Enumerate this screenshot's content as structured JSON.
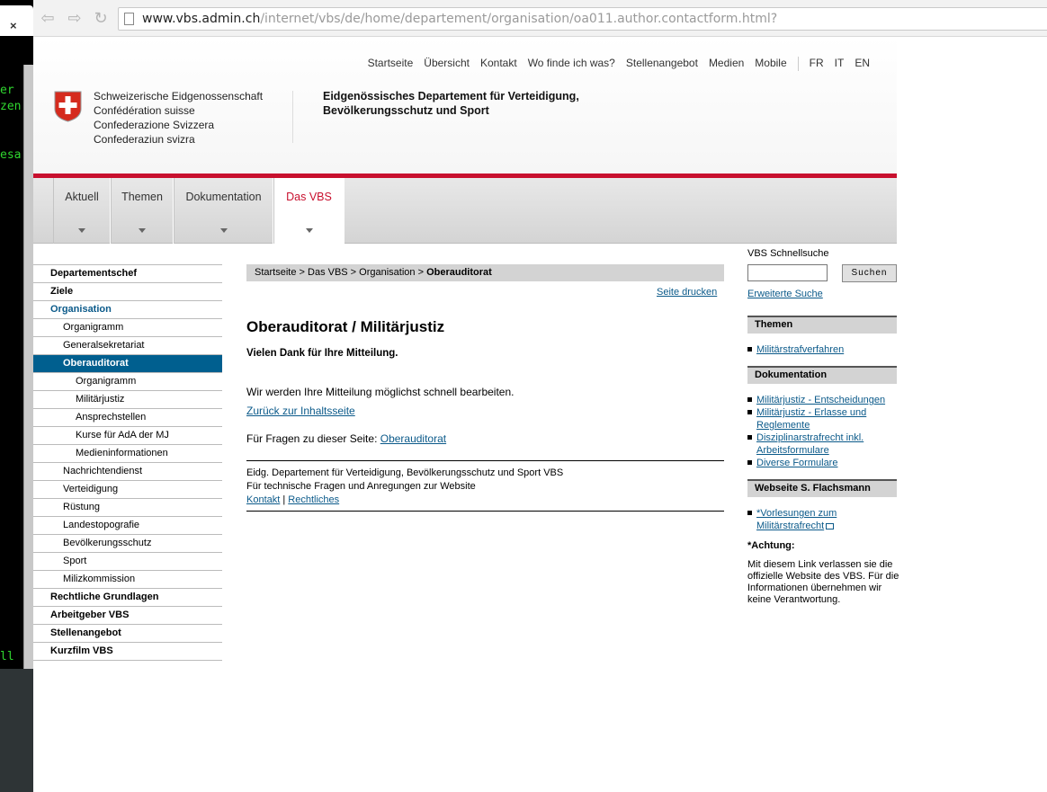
{
  "terminal": {
    "close_glyph": "×",
    "lines": [
      "er",
      "zen",
      "esa",
      "ll"
    ]
  },
  "browser": {
    "url_host": "www.vbs.admin.ch",
    "url_path": "/internet/vbs/de/home/departement/organisation/oa011.author.contactform.html?"
  },
  "header": {
    "meta_links": [
      "Startseite",
      "Übersicht",
      "Kontakt",
      "Wo finde ich was?",
      "Stellenangebot",
      "Medien",
      "Mobile"
    ],
    "languages": [
      "FR",
      "IT",
      "EN"
    ],
    "confederation": [
      "Schweizerische Eidgenossenschaft",
      "Confédération suisse",
      "Confederazione Svizzera",
      "Confederaziun svizra"
    ],
    "department": [
      "Eidgenössisches Departement für Verteidigung,",
      "Bevölkerungsschutz und Sport"
    ]
  },
  "main_nav": [
    "Aktuell",
    "Themen",
    "Dokumentation",
    "Das VBS"
  ],
  "left_nav": [
    {
      "label": "Departementschef",
      "level": 1
    },
    {
      "label": "Ziele",
      "level": 1
    },
    {
      "label": "Organisation",
      "level": 1,
      "state": "open"
    },
    {
      "label": "Organigramm",
      "level": 2
    },
    {
      "label": "Generalsekretariat",
      "level": 2
    },
    {
      "label": "Oberauditorat",
      "level": 2,
      "state": "selected"
    },
    {
      "label": "Organigramm",
      "level": 3
    },
    {
      "label": "Militärjustiz",
      "level": 3
    },
    {
      "label": "Ansprechstellen",
      "level": 3
    },
    {
      "label": "Kurse für AdA der MJ",
      "level": 3
    },
    {
      "label": "Medieninformationen",
      "level": 3
    },
    {
      "label": "Nachrichtendienst",
      "level": 2
    },
    {
      "label": "Verteidigung",
      "level": 2
    },
    {
      "label": "Rüstung",
      "level": 2
    },
    {
      "label": "Landestopografie",
      "level": 2
    },
    {
      "label": "Bevölkerungsschutz",
      "level": 2
    },
    {
      "label": "Sport",
      "level": 2
    },
    {
      "label": "Milizkommission",
      "level": 2
    },
    {
      "label": "Rechtliche Grundlagen",
      "level": 1
    },
    {
      "label": "Arbeitgeber VBS",
      "level": 1
    },
    {
      "label": "Stellenangebot",
      "level": 1
    },
    {
      "label": "Kurzfilm VBS",
      "level": 1
    }
  ],
  "breadcrumb": {
    "path": "Startseite > Das VBS > Organisation > ",
    "current": "Oberauditorat"
  },
  "content": {
    "print_link": "Seite drucken",
    "title": "Oberauditorat / Militärjustiz",
    "thanks": "Vielen Dank für Ihre Mitteilung.",
    "processing": "Wir werden Ihre Mitteilung möglichst schnell bearbeiten.",
    "back_link": "Zurück zur Inhaltsseite",
    "questions_prefix": "Für Fragen zu dieser Seite: ",
    "questions_link": "Oberauditorat",
    "footer_line1": "Eidg. Departement für Verteidigung, Bevölkerungsschutz und Sport VBS",
    "footer_line2": "Für technische Fragen und Anregungen zur Website",
    "footer_contact": "Kontakt",
    "footer_sep": " | ",
    "footer_legal": "Rechtliches"
  },
  "sidebar": {
    "search_label": "VBS Schnellsuche",
    "search_value": "",
    "search_button": "Suchen",
    "advanced_link": "Erweiterte Suche",
    "themen_title": "Themen",
    "themen_items": [
      "Militärstrafverfahren"
    ],
    "doku_title": "Dokumentation",
    "doku_items": [
      "Militärjustiz - Entscheidungen",
      "Militärjustiz - Erlasse und Reglemente",
      "Disziplinarstrafrecht inkl. Arbeitsformulare",
      "Diverse Formulare"
    ],
    "web_title": "Webseite S. Flachsmann",
    "web_items": [
      "*Vorlesungen zum Militärstrafrecht"
    ],
    "warning_title": "*Achtung:",
    "warning_text": "Mit diesem Link verlassen sie die offizielle Website des VBS. Für die Informationen übernehmen wir keine Verantwortung."
  },
  "colors": {
    "accent_red": "#c8102e",
    "selected_blue": "#005f8f",
    "link": "#0b5a8a"
  }
}
